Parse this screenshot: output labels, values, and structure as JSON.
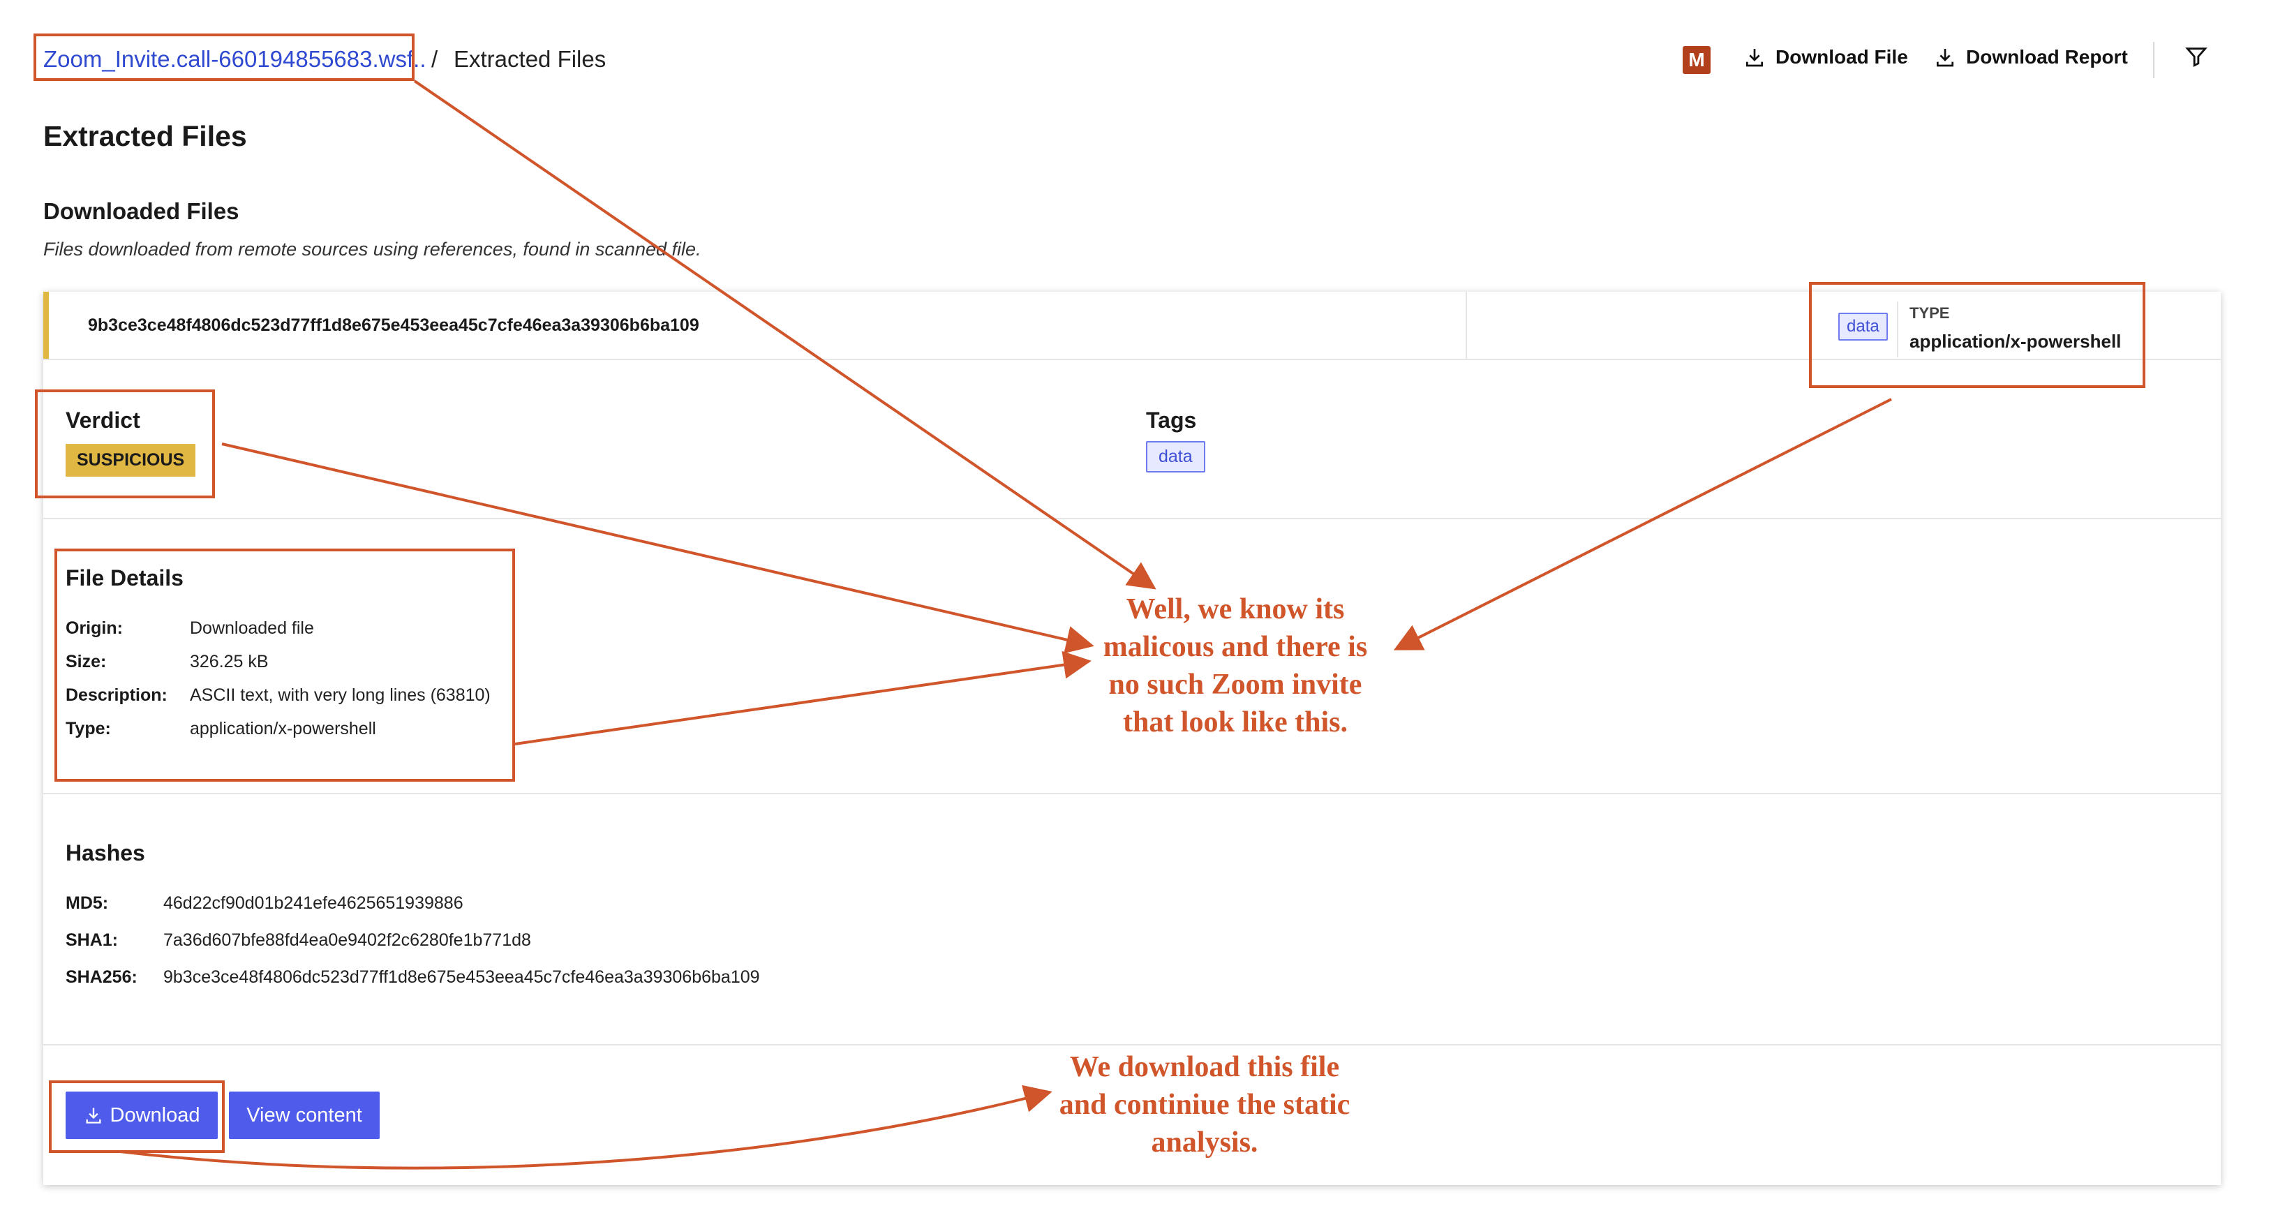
{
  "breadcrumb": {
    "parent": "Zoom_Invite.call-660194855683.wsf..",
    "separator": "/",
    "current": "Extracted Files"
  },
  "header": {
    "avatar_letter": "M",
    "download_file": "Download File",
    "download_report": "Download Report"
  },
  "page_title": "Extracted Files",
  "section": {
    "title": "Downloaded Files",
    "subtitle": "Files downloaded from remote sources using references, found in scanned file."
  },
  "file": {
    "hash": "9b3ce3ce48f4806dc523d77ff1d8e675e453eea45c7cfe46ea3a39306b6ba109",
    "type_tag": "data",
    "type_label": "TYPE",
    "type_value": "application/x-powershell",
    "verdict_label": "Verdict",
    "verdict": "SUSPICIOUS",
    "tags_label": "Tags",
    "tags": [
      "data"
    ],
    "details_title": "File Details",
    "details": [
      {
        "label": "Origin:",
        "value": "Downloaded file"
      },
      {
        "label": "Size:",
        "value": "326.25 kB"
      },
      {
        "label": "Description:",
        "value": "ASCII text, with very long lines (63810)"
      },
      {
        "label": "Type:",
        "value": "application/x-powershell"
      }
    ],
    "hashes_title": "Hashes",
    "hashes": [
      {
        "label": "MD5:",
        "value": "46d22cf90d01b241efe4625651939886"
      },
      {
        "label": "SHA1:",
        "value": "7a36d607bfe88fd4ea0e9402f2c6280fe1b771d8"
      },
      {
        "label": "SHA256:",
        "value": "9b3ce3ce48f4806dc523d77ff1d8e675e453eea45c7cfe46ea3a39306b6ba109"
      }
    ],
    "download_button": "Download",
    "view_button": "View content"
  },
  "annotations": {
    "note1": [
      "Well, we know its",
      "malicous and there is",
      "no such Zoom invite",
      "that look like this."
    ],
    "note2": [
      "We download this file",
      "and continiue the static",
      "analysis."
    ],
    "color": "#d0552a"
  },
  "colors": {
    "accent": "#4f5bea",
    "suspicious": "#e1b744",
    "link": "#2f49d1",
    "avatar": "#b3401d"
  }
}
